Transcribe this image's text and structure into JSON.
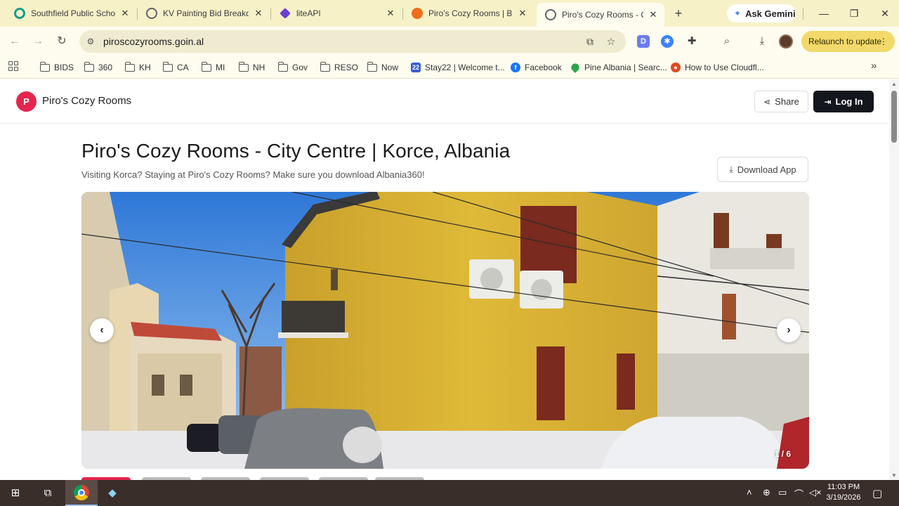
{
  "browser": {
    "tabs": [
      {
        "title": "Southfield Public School",
        "favicon_color": "#1a9c8c"
      },
      {
        "title": "KV Painting Bid Breakdo",
        "favicon_color": "#5f6368"
      },
      {
        "title": "liteAPI",
        "favicon_color": "#6b3fd6"
      },
      {
        "title": "Piro's Cozy Rooms | Base",
        "favicon_color": "#ef6c1a"
      },
      {
        "title": "Piro's Cozy Rooms - City",
        "favicon_color": "#5f6368",
        "active": true
      }
    ],
    "new_tab": "+",
    "ask_gemini": "Ask Gemini",
    "window_controls": {
      "minimize": "—",
      "restore": "❐",
      "close": "✕"
    },
    "url": "piroscozyrooms.goin.al",
    "relaunch_label": "Relaunch to update",
    "bookmarks": [
      {
        "label": "BIDS",
        "type": "folder"
      },
      {
        "label": "360",
        "type": "folder"
      },
      {
        "label": "KH",
        "type": "folder"
      },
      {
        "label": "CA",
        "type": "folder"
      },
      {
        "label": "MI",
        "type": "folder"
      },
      {
        "label": "NH",
        "type": "folder"
      },
      {
        "label": "Gov",
        "type": "folder"
      },
      {
        "label": "RESO",
        "type": "folder"
      },
      {
        "label": "Now",
        "type": "folder"
      },
      {
        "label": "Stay22 | Welcome t...",
        "type": "link",
        "icon_color": "#3a5bd9"
      },
      {
        "label": "Facebook",
        "type": "link",
        "icon_color": "#1877f2"
      },
      {
        "label": "Pine Albania | Searc...",
        "type": "link",
        "icon_color": "#2aa64a"
      },
      {
        "label": "How to Use Cloudfl...",
        "type": "link",
        "icon_color": "#e04a1f"
      }
    ]
  },
  "site": {
    "logo_letter": "P",
    "brand": "Piro's Cozy Rooms",
    "share_label": "Share",
    "login_label": "Log In",
    "title": "Piro's Cozy Rooms - City Centre | Korce, Albania",
    "subtitle": "Visiting Korca? Staying at Piro's Cozy Rooms? Make sure you download Albania360!",
    "download_label": "Download App",
    "gallery": {
      "counter": "1 / 6",
      "prev": "‹",
      "next": "›"
    }
  },
  "taskbar": {
    "time": "11:03 PM",
    "date": "3/19/2026"
  }
}
